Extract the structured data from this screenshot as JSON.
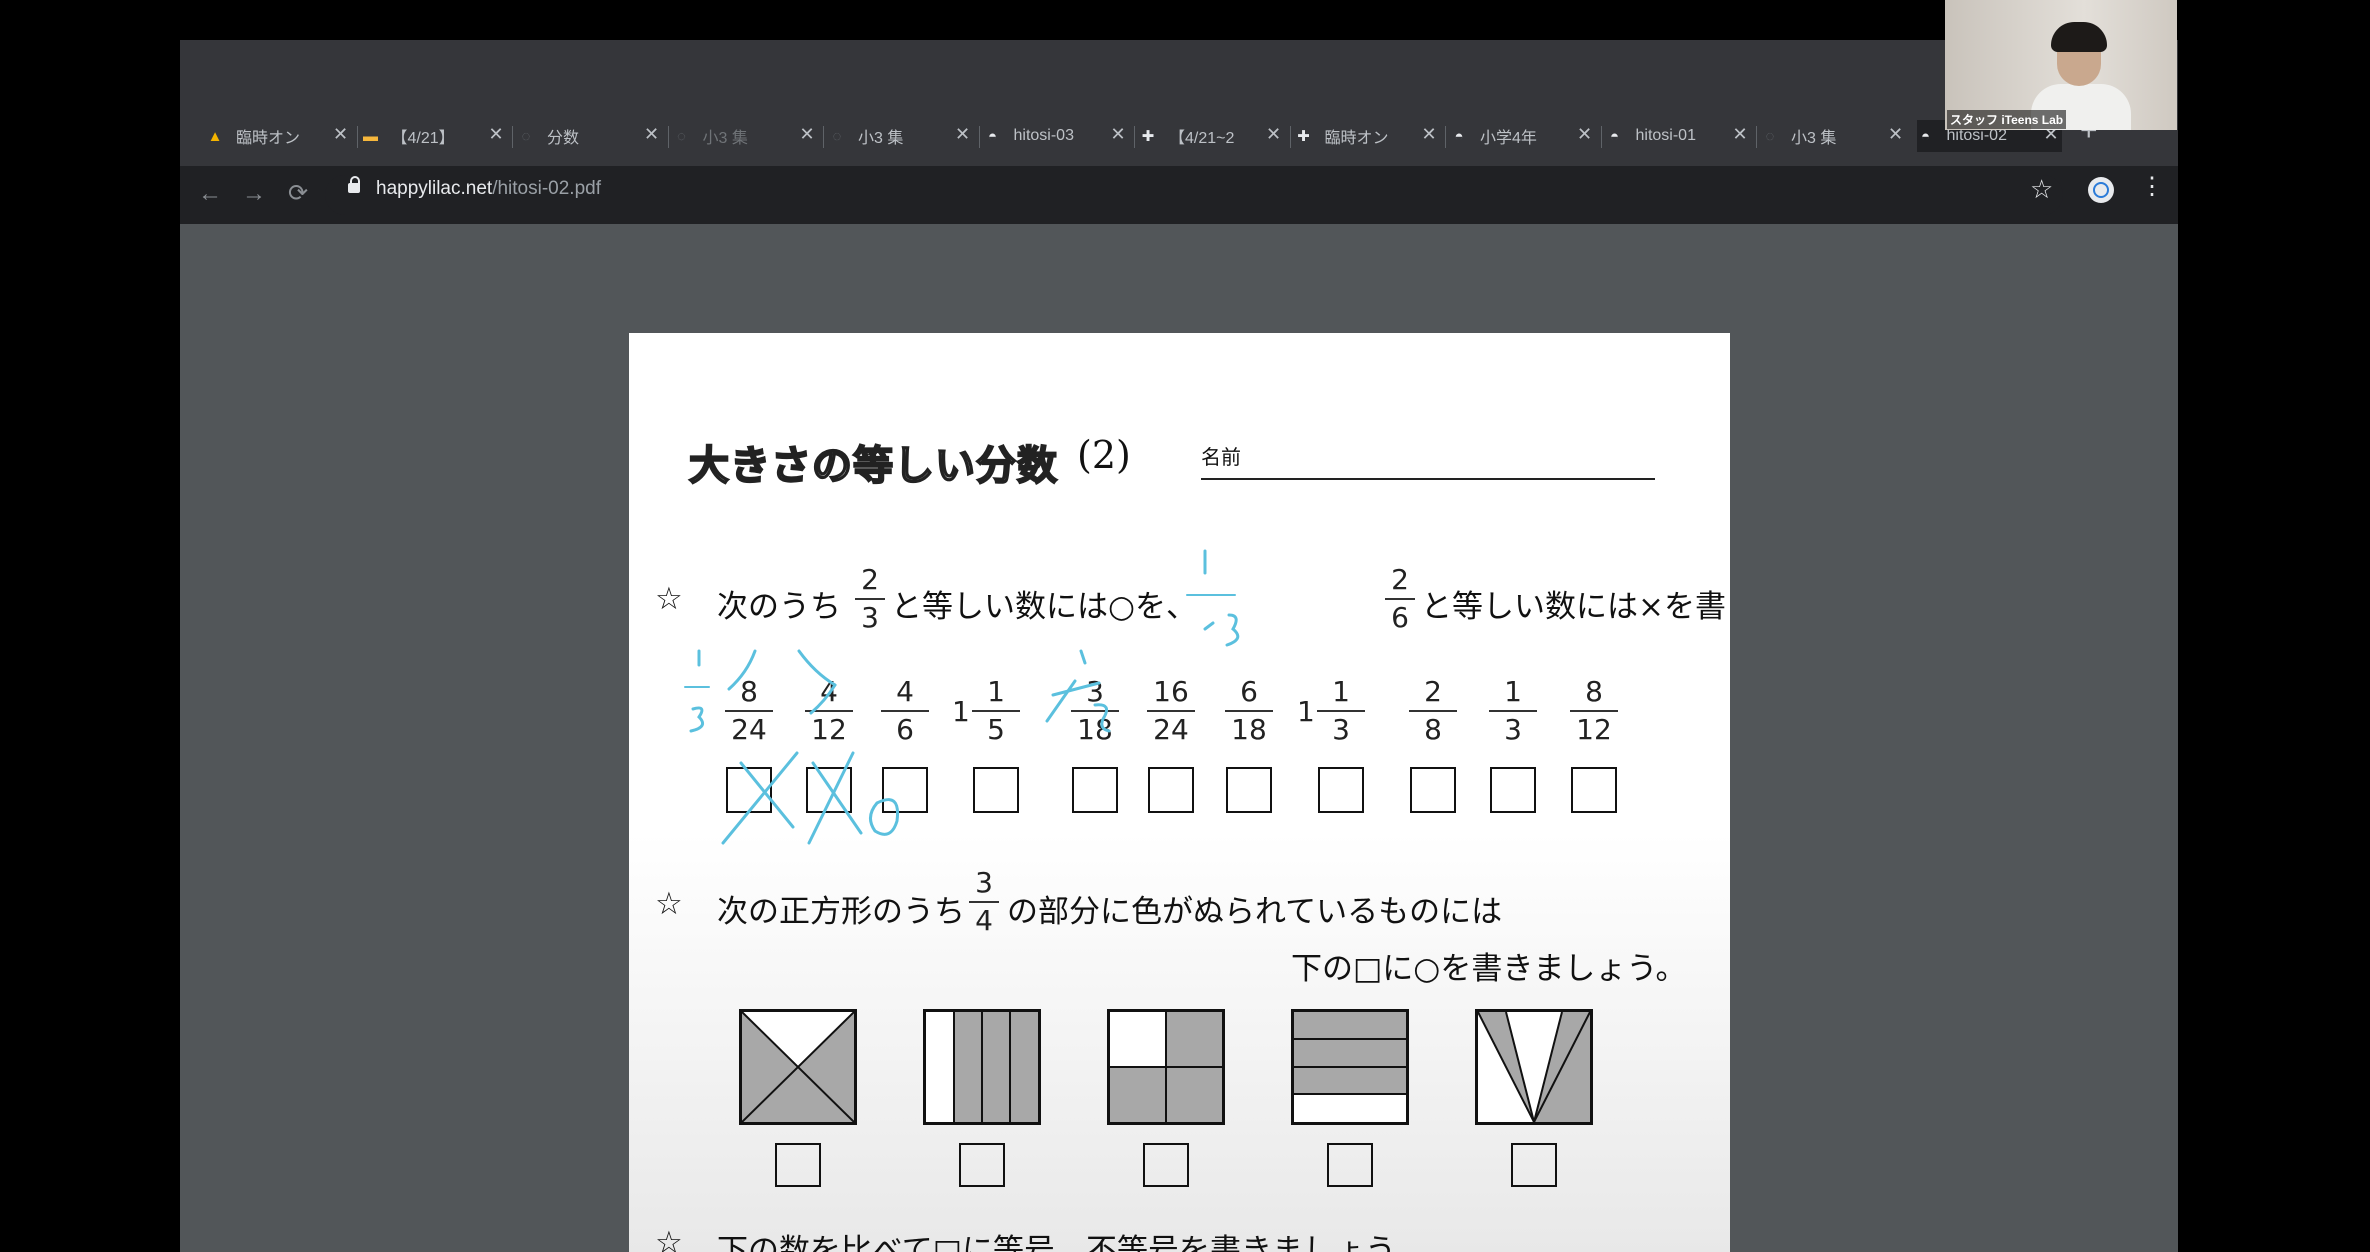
{
  "tabs": [
    {
      "label": "臨時オン",
      "icon": "drive-icon",
      "state": "normal"
    },
    {
      "label": "【4/21】",
      "icon": "slides-icon",
      "state": "normal"
    },
    {
      "label": "分数",
      "icon": "globe-icon",
      "state": "normal"
    },
    {
      "label": "小3 集",
      "icon": "globe-icon",
      "state": "dim"
    },
    {
      "label": "小3 集",
      "icon": "globe-icon",
      "state": "normal"
    },
    {
      "label": "hitosi-03",
      "icon": "happylilac-icon",
      "state": "normal"
    },
    {
      "label": "【4/21~2",
      "icon": "cross-doc-icon",
      "state": "normal"
    },
    {
      "label": "臨時オン",
      "icon": "cross-doc-icon",
      "state": "normal"
    },
    {
      "label": "小学4年",
      "icon": "happylilac-icon",
      "state": "normal"
    },
    {
      "label": "hitosi-01",
      "icon": "happylilac-icon",
      "state": "normal"
    },
    {
      "label": "小3 集",
      "icon": "globe-icon",
      "state": "normal"
    },
    {
      "label": "hitosi-02",
      "icon": "happylilac-icon",
      "state": "active"
    }
  ],
  "tab_close": "✕",
  "new_tab": "+",
  "toolbar": {
    "back": "←",
    "forward": "→",
    "reload": "⟳",
    "url_host": "happylilac.net",
    "url_path": "/hitosi-02.pdf",
    "star": "☆",
    "menu": "⋮"
  },
  "video": {
    "label": "スタッフ iTeens Lab"
  },
  "worksheet": {
    "title": "大きさの等しい分数",
    "title_num": "(2)",
    "name_label": "名前",
    "q1": {
      "star": "☆",
      "text_a": "次のうち",
      "frac_a": {
        "num": "2",
        "den": "3"
      },
      "text_b": "と等しい数には○を、",
      "frac_b": {
        "num": "2",
        "den": "6"
      },
      "text_c": "と等しい数には×を書きましょう。"
    },
    "fractions": [
      {
        "whole": "",
        "num": "8",
        "den": "24"
      },
      {
        "whole": "",
        "num": "4",
        "den": "12"
      },
      {
        "whole": "",
        "num": "4",
        "den": "6"
      },
      {
        "whole": "1",
        "num": "1",
        "den": "5"
      },
      {
        "whole": "",
        "num": "3",
        "den": "18"
      },
      {
        "whole": "",
        "num": "16",
        "den": "24"
      },
      {
        "whole": "",
        "num": "6",
        "den": "18"
      },
      {
        "whole": "1",
        "num": "1",
        "den": "3"
      },
      {
        "whole": "",
        "num": "2",
        "den": "8"
      },
      {
        "whole": "",
        "num": "1",
        "den": "3"
      },
      {
        "whole": "",
        "num": "8",
        "den": "12"
      }
    ],
    "q2": {
      "star": "☆",
      "text_a": "次の正方形のうち",
      "frac": {
        "num": "3",
        "den": "4"
      },
      "text_b": "の部分に色がぬられているものには",
      "text_c": "下の□に○を書きましょう。"
    },
    "q3": {
      "star": "☆",
      "text": "下の数を比べて□に等号、不等号を書きましょう。"
    }
  },
  "colors": {
    "annotation": "#5bc0de",
    "shade": "#a8a8a8",
    "tabstrip": "#35363a"
  }
}
